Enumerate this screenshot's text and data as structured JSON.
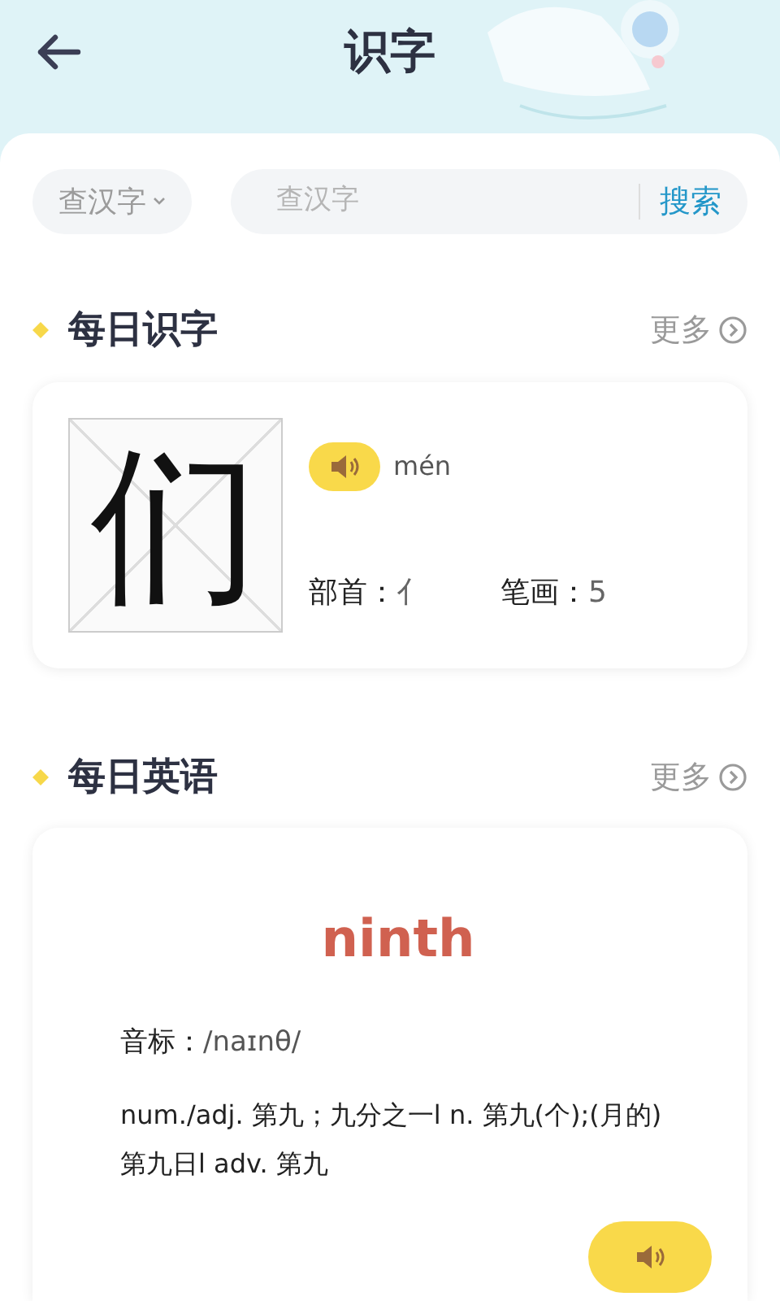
{
  "header": {
    "title": "识字"
  },
  "search": {
    "mode": "查汉字",
    "placeholder": "查汉字",
    "button": "搜索"
  },
  "daily_character": {
    "heading": "每日识字",
    "more": "更多",
    "character": "们",
    "pinyin": "mén",
    "radical_label": "部首：",
    "radical": "亻",
    "strokes_label": "笔画：",
    "strokes": "5"
  },
  "daily_english": {
    "heading": "每日英语",
    "more": "更多",
    "word": "ninth",
    "phonetic_label": "音标：",
    "phonetic": "/naɪnθ/",
    "definition": "num./adj. 第九；九分之一l n. 第九(个);(月的)第九日l adv. 第九"
  }
}
